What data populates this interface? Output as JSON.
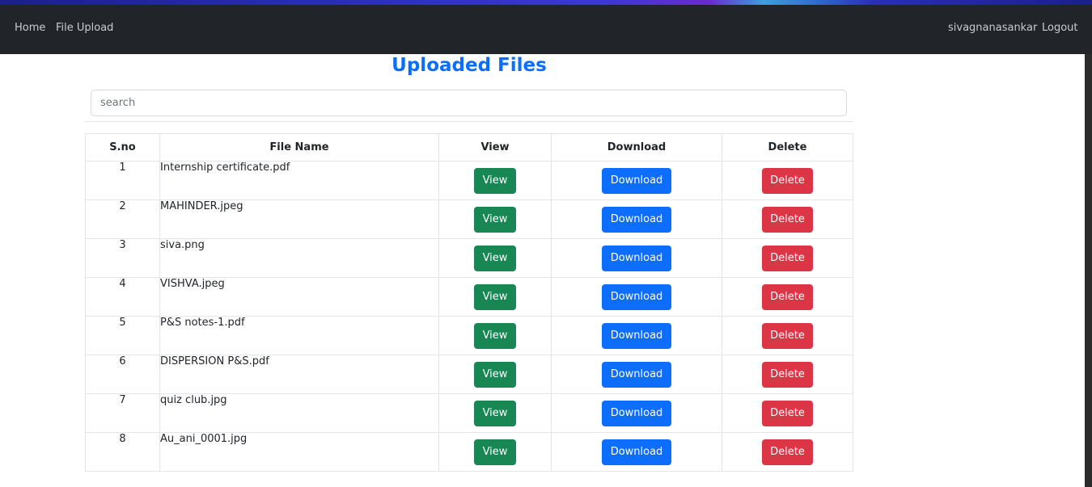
{
  "nav": {
    "home": "Home",
    "file_upload": "File Upload",
    "username": "sivagnanasankar",
    "logout": "Logout"
  },
  "page": {
    "title": "Uploaded Files",
    "search_placeholder": "search"
  },
  "table": {
    "headers": [
      "S.no",
      "File Name",
      "View",
      "Download",
      "Delete"
    ],
    "rows": [
      {
        "sno": "1",
        "file": "Internship certificate.pdf"
      },
      {
        "sno": "2",
        "file": "MAHINDER.jpeg"
      },
      {
        "sno": "3",
        "file": "siva.png"
      },
      {
        "sno": "4",
        "file": "VISHVA.jpeg"
      },
      {
        "sno": "5",
        "file": "P&S notes-1.pdf"
      },
      {
        "sno": "6",
        "file": "DISPERSION P&S.pdf"
      },
      {
        "sno": "7",
        "file": "quiz club.jpg"
      },
      {
        "sno": "8",
        "file": "Au_ani_0001.jpg"
      }
    ],
    "view_label": "View",
    "download_label": "Download",
    "delete_label": "Delete"
  },
  "colors": {
    "navbar": "#212529",
    "title": "#0d6efd",
    "view": "#198754",
    "download": "#0d6efd",
    "delete": "#dc3545"
  }
}
